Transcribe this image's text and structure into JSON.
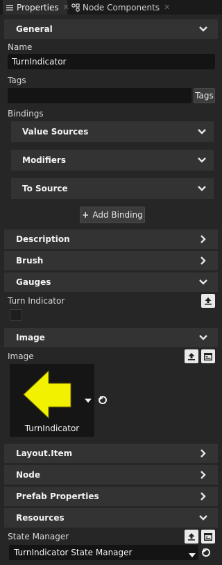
{
  "tabs": [
    {
      "label": "Properties",
      "icon": "properties-icon",
      "active": true
    },
    {
      "label": "Node Components",
      "icon": "node-components-icon",
      "active": false
    }
  ],
  "sections": {
    "general": "General",
    "description": "Description",
    "brush": "Brush",
    "gauges": "Gauges",
    "image": "Image",
    "layout_item": "Layout.Item",
    "node": "Node",
    "prefab_properties": "Prefab Properties",
    "resources": "Resources"
  },
  "general": {
    "name_label": "Name",
    "name_value": "TurnIndicator",
    "tags_label": "Tags",
    "tags_value": "",
    "tags_button": "Tags",
    "bindings_label": "Bindings",
    "value_sources": "Value Sources",
    "modifiers": "Modifiers",
    "to_source": "To Source",
    "add_binding": "Add Binding"
  },
  "gauges": {
    "turn_indicator_label": "Turn Indicator",
    "swatch_color": "#1e1e1e"
  },
  "image": {
    "image_label": "Image",
    "thumbnail_caption": "TurnIndicator",
    "arrow_color": "#f2f200"
  },
  "resources": {
    "state_manager_label": "State Manager",
    "state_manager_value": "TurnIndicator State Manager"
  }
}
